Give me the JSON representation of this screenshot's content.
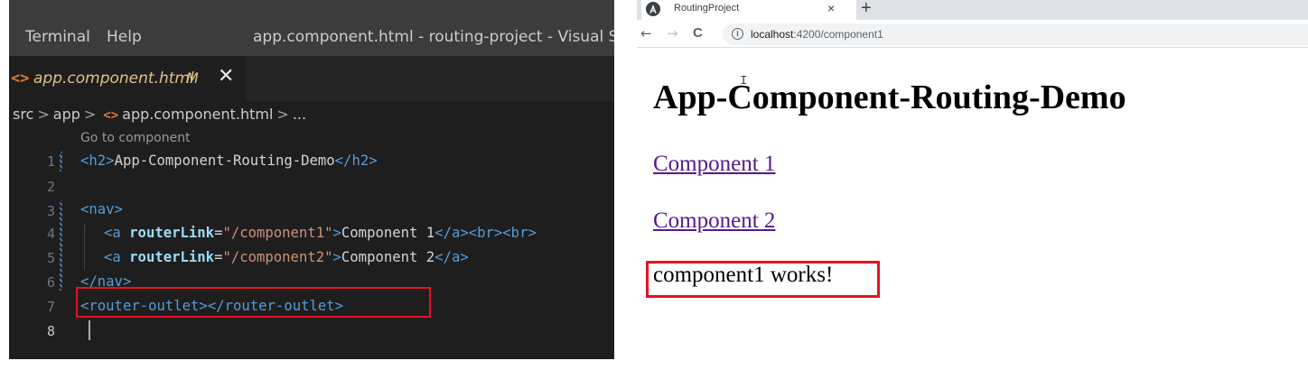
{
  "vscode": {
    "menu": [
      "Terminal",
      "Help"
    ],
    "window_title": "app.component.html - routing-project - Visual Studio",
    "tab": {
      "icon": "html-file-icon",
      "icon_glyph": "<>",
      "name": "app.component.html",
      "status": "M",
      "close_glyph": "✕"
    },
    "breadcrumb": {
      "parts": [
        "src",
        "app",
        "app.component.html",
        "..."
      ],
      "separator": ">",
      "file_icon_glyph": "<>"
    },
    "codelens": "Go to component",
    "line_numbers": [
      "1",
      "2",
      "3",
      "4",
      "5",
      "6",
      "7",
      "8"
    ],
    "code_lines": {
      "line1": {
        "open": "<h2>",
        "text": "App-Component-Routing-Demo",
        "close": "</h2>"
      },
      "line3": {
        "open": "<nav>"
      },
      "line4": {
        "tag_open": "<a",
        "attr": "routerLink",
        "eq": "=",
        "value": "\"/component1\"",
        "gt": ">",
        "text": "Component 1",
        "close": "</a><br><br>"
      },
      "line5": {
        "tag_open": "<a",
        "attr": "routerLink",
        "eq": "=",
        "value": "\"/component2\"",
        "gt": ">",
        "text": "Component 2",
        "close": "</a>"
      },
      "line6": {
        "close": "</nav>"
      },
      "line7": {
        "tag": "<router-outlet></router-outlet>"
      }
    },
    "highlight_color": "#e81123"
  },
  "browser": {
    "tab_title": "RoutingProject",
    "tab_icon": "angular-icon",
    "tab_close_glyph": "×",
    "new_tab_glyph": "+",
    "nav": {
      "back_glyph": "←",
      "forward_glyph": "→",
      "reload_glyph": "C"
    },
    "info_icon_glyph": "i",
    "url_host": "localhost",
    "url_path": ":4200/component1",
    "page": {
      "heading": "App-Component-Routing-Demo",
      "links": [
        "Component 1",
        "Component 2"
      ],
      "output_text": "component1 works!"
    },
    "highlight_color": "#e81123"
  }
}
